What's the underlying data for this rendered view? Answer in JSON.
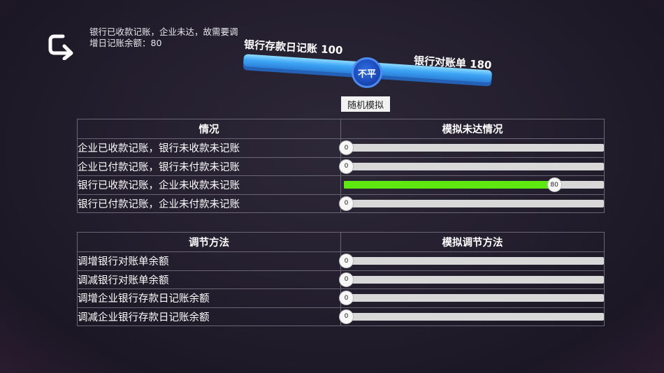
{
  "hint_text": "银行已收款记账，企业未达，故需要调增日记账余额：80",
  "balance": {
    "left_label": "银行存款日记账 100",
    "right_label": "银行对账单 180",
    "status": "不平",
    "beam_color": "#3fa6f5",
    "pivot_color": "#1b49b8"
  },
  "simulate_button": "随机模拟",
  "table1": {
    "headers": [
      "情况",
      "模拟未达情况"
    ],
    "rows": [
      {
        "label": "企业已收款记账，银行未收款未记账",
        "value": "0",
        "fraction": 0
      },
      {
        "label": "企业已付款记账，银行未付款未记账",
        "value": "0",
        "fraction": 0
      },
      {
        "label": "银行已收款记账，企业未收款未记账",
        "value": "80",
        "fraction": 0.8
      },
      {
        "label": "银行已付款记账，企业未付款未记账",
        "value": "0",
        "fraction": 0
      }
    ]
  },
  "table2": {
    "headers": [
      "调节方法",
      "模拟调节方法"
    ],
    "rows": [
      {
        "label": "调增银行对账单余额",
        "value": "0",
        "fraction": 0
      },
      {
        "label": "调减银行对账单余额",
        "value": "0",
        "fraction": 0
      },
      {
        "label": "调增企业银行存款日记账余额",
        "value": "0",
        "fraction": 0
      },
      {
        "label": "调减企业银行存款日记账余额",
        "value": "0",
        "fraction": 0
      }
    ]
  },
  "colors": {
    "slider_fill": "#5fe80f",
    "slider_track": "#d8d8d8"
  },
  "icons": {
    "back": "back-arrow-icon"
  }
}
